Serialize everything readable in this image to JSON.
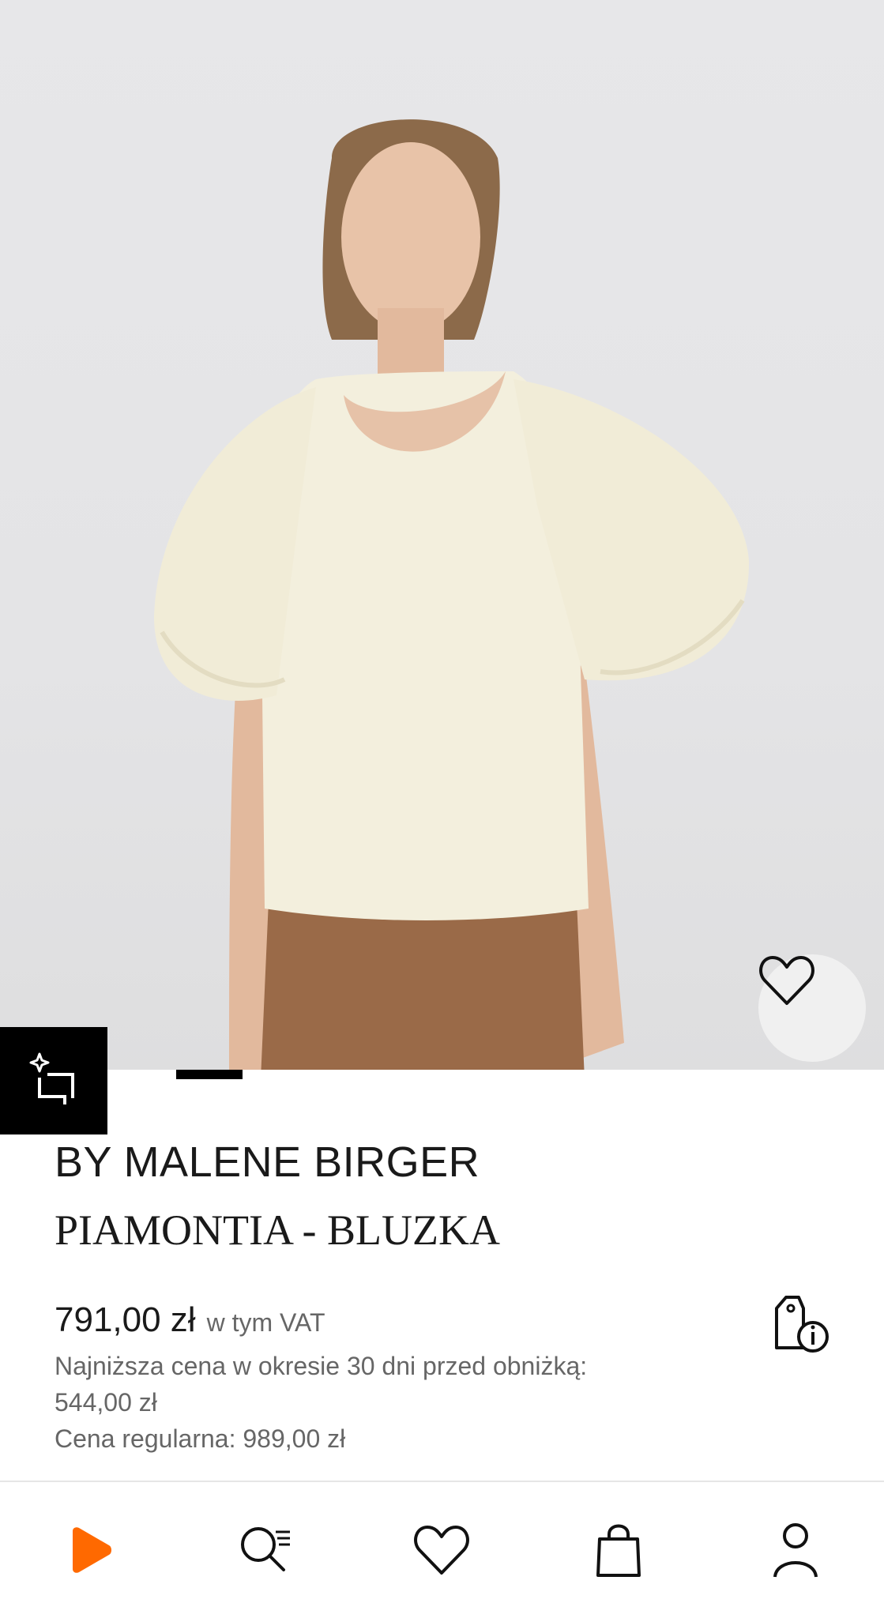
{
  "product": {
    "brand": "BY MALENE BIRGER",
    "name": "PIAMONTIA - BLUZKA",
    "price": "791,00 zł",
    "vat_note": "w tym VAT",
    "lowest_price_label": "Najniższa cena w okresie 30 dni przed obniżką:",
    "lowest_price_value": "544,00 zł",
    "regular_price": "Cena regularna: 989,00 zł"
  },
  "gallery": {
    "image_position_fraction": 0.125,
    "icons": {
      "favorite": "heart-icon",
      "similar": "sparkle-crop-icon"
    }
  },
  "bottom_nav": {
    "items": [
      {
        "name": "home",
        "icon": "zalando-play-logo-icon"
      },
      {
        "name": "search",
        "icon": "search-icon"
      },
      {
        "name": "wishlist",
        "icon": "heart-icon"
      },
      {
        "name": "bag",
        "icon": "shopping-bag-icon"
      },
      {
        "name": "account",
        "icon": "person-icon"
      }
    ]
  },
  "colors": {
    "brand_orange": "#ff6900",
    "text": "#1a1a1a",
    "muted": "#666666"
  }
}
